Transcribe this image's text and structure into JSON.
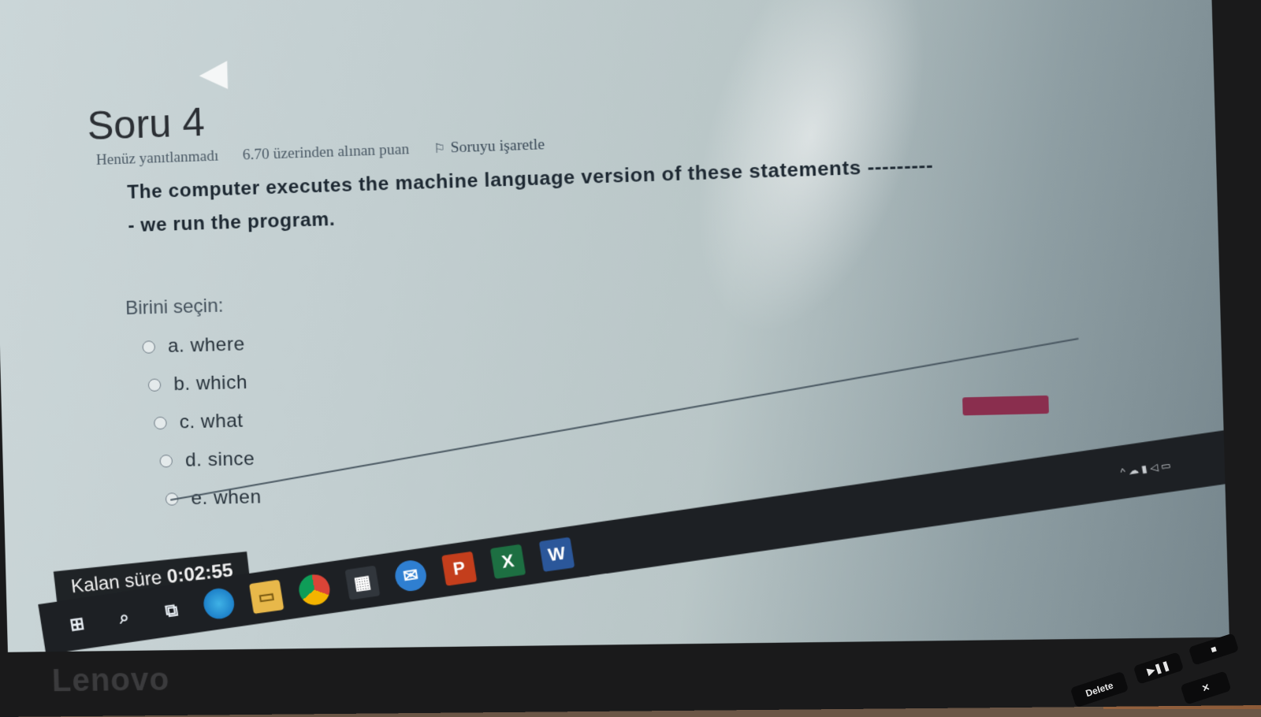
{
  "question": {
    "title": "Soru 4",
    "status": "Henüz yanıtlanmadı",
    "points": "6.70 üzerinden alınan puan",
    "flag_label": "Soruyu işaretle",
    "text": "The computer executes the machine language version of these statements ---------- we run the program.",
    "prompt": "Birini seçin:",
    "options": [
      {
        "label": "a. where"
      },
      {
        "label": "b. which"
      },
      {
        "label": "c. what"
      },
      {
        "label": "d. since"
      },
      {
        "label": "e. when"
      }
    ]
  },
  "timer": {
    "label": "Kalan süre",
    "value": "0:02:55"
  },
  "device": {
    "brand": "Lenovo"
  },
  "keyboard": {
    "delete_label": "Delete"
  },
  "taskbar": {
    "icons": [
      "windows-start-icon",
      "search-icon",
      "task-view-icon",
      "edge-icon",
      "file-explorer-icon",
      "chrome-icon",
      "store-icon",
      "mail-icon",
      "powerpoint-icon",
      "excel-icon",
      "word-icon"
    ]
  }
}
